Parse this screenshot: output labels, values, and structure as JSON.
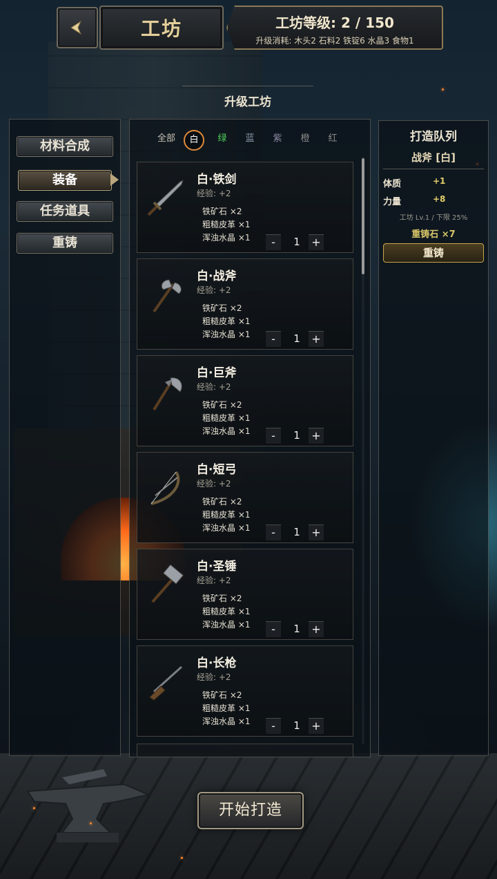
{
  "header": {
    "back_icon": "back-arrow-icon",
    "title": "工坊",
    "level_text": "工坊等级: 2 / 150",
    "upgrade_cost": "升级消耗: 木头2 石料2 铁锭6 水晶3 食物1"
  },
  "upgrade_label": "升级工坊",
  "sidebar": {
    "items": [
      {
        "label": "材料合成",
        "active": false
      },
      {
        "label": "装备",
        "active": true
      },
      {
        "label": "任务道具",
        "active": false
      },
      {
        "label": "重铸",
        "active": false
      }
    ]
  },
  "filters": [
    {
      "label": "全部",
      "color": "#c8c3b5"
    },
    {
      "label": "白",
      "color": "#ffffff",
      "active": true
    },
    {
      "label": "绿",
      "color": "#4fd15a"
    },
    {
      "label": "蓝",
      "color": "#8a96a8"
    },
    {
      "label": "紫",
      "color": "#8a86a0"
    },
    {
      "label": "橙",
      "color": "#8a8a88"
    },
    {
      "label": "红",
      "color": "#8a8a88"
    }
  ],
  "recipes": [
    {
      "name": "白·铁剑",
      "exp": "经验: +2",
      "icon": "sword-icon",
      "materials": [
        "铁矿石 ×2",
        "粗糙皮革 ×1",
        "浑浊水晶 ×1"
      ],
      "minus": "-",
      "qty": "1",
      "plus": "+"
    },
    {
      "name": "白·战斧",
      "exp": "经验: +2",
      "icon": "battle-axe-icon",
      "materials": [
        "铁矿石 ×2",
        "粗糙皮革 ×1",
        "浑浊水晶 ×1"
      ],
      "minus": "-",
      "qty": "1",
      "plus": "+"
    },
    {
      "name": "白·巨斧",
      "exp": "经验: +2",
      "icon": "great-axe-icon",
      "materials": [
        "铁矿石 ×2",
        "粗糙皮革 ×1",
        "浑浊水晶 ×1"
      ],
      "minus": "-",
      "qty": "1",
      "plus": "+"
    },
    {
      "name": "白·短弓",
      "exp": "经验: +2",
      "icon": "bow-icon",
      "materials": [
        "铁矿石 ×2",
        "粗糙皮革 ×1",
        "浑浊水晶 ×1"
      ],
      "minus": "-",
      "qty": "1",
      "plus": "+"
    },
    {
      "name": "白·圣锤",
      "exp": "经验: +2",
      "icon": "hammer-icon",
      "materials": [
        "铁矿石 ×2",
        "粗糙皮革 ×1",
        "浑浊水晶 ×1"
      ],
      "minus": "-",
      "qty": "1",
      "plus": "+"
    },
    {
      "name": "白·长枪",
      "exp": "经验: +2",
      "icon": "musket-icon",
      "materials": [
        "铁矿石 ×2",
        "粗糙皮革 ×1",
        "浑浊水晶 ×1"
      ],
      "minus": "-",
      "qty": "1",
      "plus": "+"
    }
  ],
  "queue": {
    "title": "打造队列",
    "item": "战斧 [白]",
    "stats": [
      {
        "name": "体质",
        "value": "+1"
      },
      {
        "name": "力量",
        "value": "+8"
      }
    ],
    "workshop_note": "工坊 Lv.1 / 下限 25%",
    "reforge_stone": "重铸石 ×7",
    "reforge_button": "重铸"
  },
  "start_button": "开始打造"
}
